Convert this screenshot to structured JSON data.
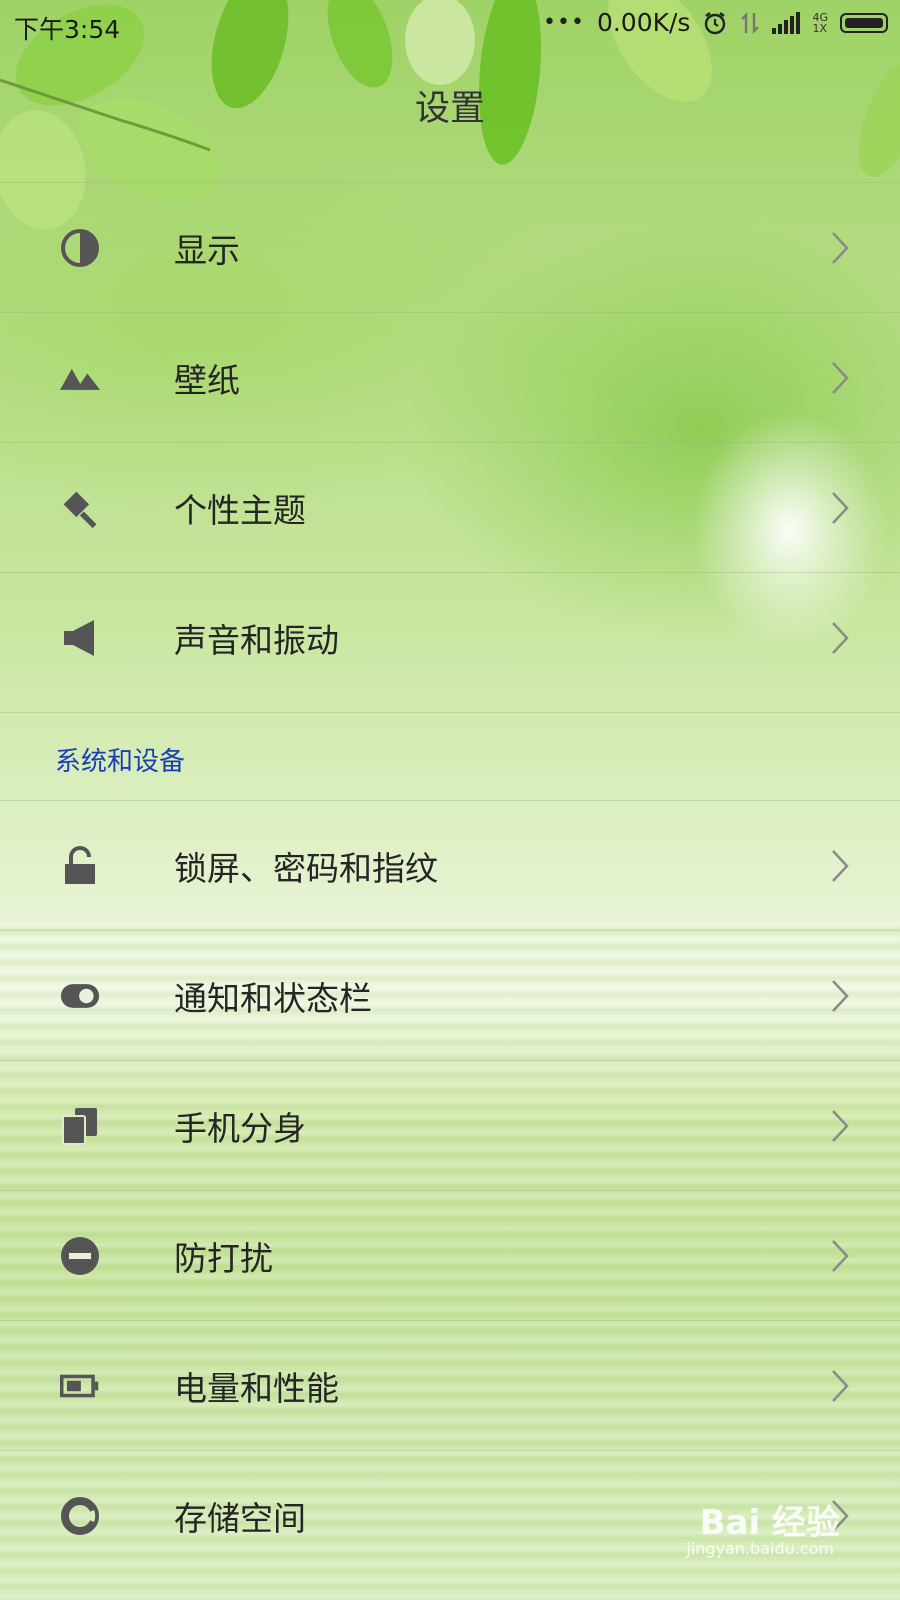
{
  "status_bar": {
    "time": "下午3:54",
    "dots": "•••",
    "net_speed": "0.00K/s",
    "net_type_top": "4G",
    "net_type_bottom": "1X"
  },
  "header": {
    "title": "设置"
  },
  "settings_group_1": [
    {
      "label": "显示",
      "icon": "display-contrast-icon"
    },
    {
      "label": "壁纸",
      "icon": "wallpaper-mountain-icon"
    },
    {
      "label": "个性主题",
      "icon": "theme-brush-icon"
    },
    {
      "label": "声音和振动",
      "icon": "speaker-icon"
    }
  ],
  "section_system": {
    "title": "系统和设备"
  },
  "settings_group_2": [
    {
      "label": "锁屏、密码和指纹",
      "icon": "lock-icon"
    },
    {
      "label": "通知和状态栏",
      "icon": "toggle-icon"
    },
    {
      "label": "手机分身",
      "icon": "dual-phone-icon"
    },
    {
      "label": "防打扰",
      "icon": "do-not-disturb-icon"
    },
    {
      "label": "电量和性能",
      "icon": "battery-icon"
    },
    {
      "label": "存储空间",
      "icon": "storage-pie-icon"
    }
  ],
  "watermark": {
    "brand": "Bai 经验",
    "url": "jingyan.baidu.com"
  },
  "colors": {
    "icon": "#555555",
    "text": "#252525",
    "section_title": "#1a3fb5",
    "arrow": "#8a8a8a"
  }
}
